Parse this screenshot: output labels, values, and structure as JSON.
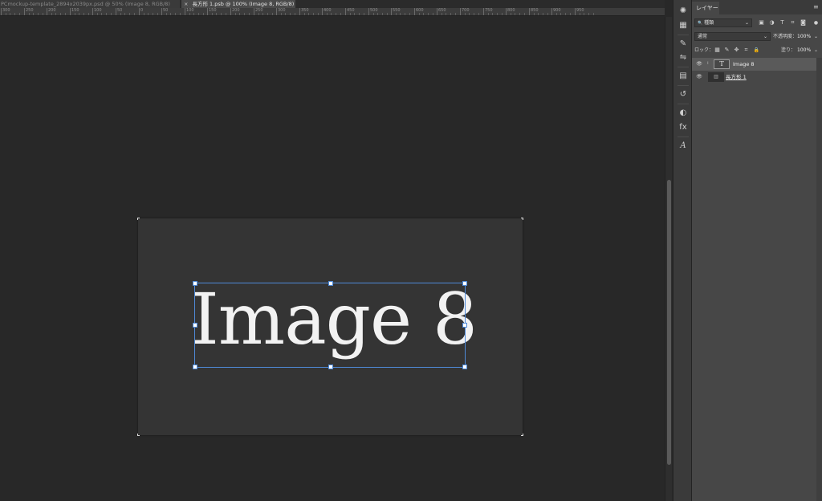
{
  "document_tabs": [
    {
      "label": "PCmockup-template_2894x2039px.psd @ 50% (Image 8, RGB/8)"
    },
    {
      "label": "長方形 1.psb @ 100% (Image 8, RGB/8)",
      "close_icon": "×"
    }
  ],
  "ruler": {
    "labels": [
      "300",
      "250",
      "200",
      "150",
      "100",
      "50",
      "0",
      "50",
      "100",
      "150",
      "200",
      "250",
      "300",
      "350",
      "400",
      "450",
      "500",
      "550",
      "600",
      "650",
      "700",
      "750",
      "800",
      "850",
      "900",
      "950"
    ]
  },
  "canvas": {
    "text": "Image 8"
  },
  "toolstrip": {
    "icons": [
      "learn-icon",
      "libraries-icon",
      "brush-settings-icon",
      "adjust-sliders-icon",
      "layer-comps-icon",
      "history-icon",
      "adjustments-icon",
      "styles-icon",
      "character-icon"
    ]
  },
  "layers_panel": {
    "tab_label": "レイヤー",
    "menu_icon": "≡",
    "filter": {
      "label": "種類",
      "search_icon": "🔍"
    },
    "filter_icons": [
      "▣",
      "◑",
      "T",
      "⌗",
      "◙"
    ],
    "blend_mode": "通常",
    "opacity_label": "不透明度：",
    "opacity_value": "100%",
    "lock_label": "ロック：",
    "lock_icons": [
      "▦",
      "✎",
      "✥",
      "⌗",
      "🔒"
    ],
    "fill_label": "塗り：",
    "fill_value": "100%",
    "layers": [
      {
        "name": "Image 8",
        "thumb": "T",
        "visible_icon": "👁"
      },
      {
        "name": "長方形 1",
        "thumb": "▥",
        "visible_icon": "👁"
      }
    ]
  }
}
